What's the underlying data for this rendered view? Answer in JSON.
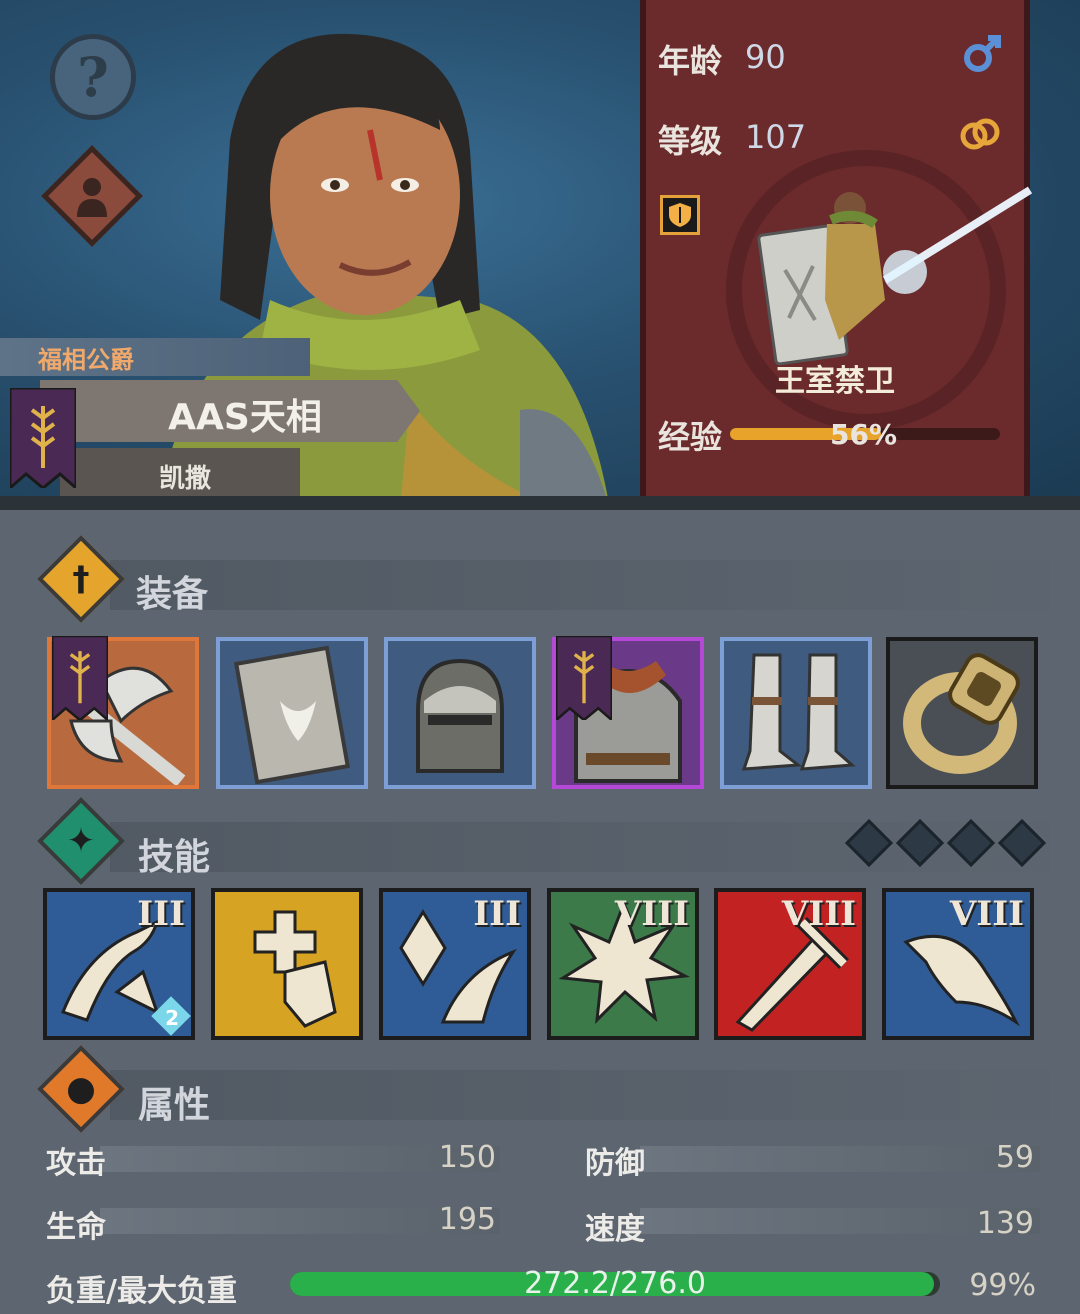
{
  "hero": {
    "title": "福相公爵",
    "name": "AAS天相",
    "sub_name": "凯撒"
  },
  "stats": {
    "age_label": "年龄",
    "age_value": "90",
    "level_label": "等级",
    "level_value": "107",
    "gender_icon": "male-icon",
    "marriage_icon": "rings-icon",
    "unit_name": "王室禁卫",
    "exp_label": "经验",
    "exp_text": "56%",
    "exp_fraction": 0.56
  },
  "equipment": {
    "title": "装备",
    "slots": [
      {
        "name": "weapon-axe",
        "border": "#e0773a",
        "bg": "#b86a3e"
      },
      {
        "name": "shield",
        "border": "#7d9fd6",
        "bg": "#3f5b80"
      },
      {
        "name": "helmet",
        "border": "#7d9fd6",
        "bg": "#3f5b80"
      },
      {
        "name": "chainmail-armor",
        "border": "#b548d6",
        "bg": "#6a3a88"
      },
      {
        "name": "greaves",
        "border": "#7d9fd6",
        "bg": "#3f5b80"
      },
      {
        "name": "ring",
        "border": "#1a1a1a",
        "bg": "#4a4f55"
      }
    ]
  },
  "skills": {
    "title": "技能",
    "items": [
      {
        "name": "skill-charge-break",
        "rank": "III",
        "bg": "#2f5c96",
        "badge": "2"
      },
      {
        "name": "skill-heal-shield",
        "rank": "",
        "bg": "#d7a323"
      },
      {
        "name": "skill-crystal-charge",
        "rank": "III",
        "bg": "#2f5c96"
      },
      {
        "name": "skill-burst",
        "rank": "VIII",
        "bg": "#3c7a4a"
      },
      {
        "name": "skill-sword",
        "rank": "VIII",
        "bg": "#c22222"
      },
      {
        "name": "skill-charge",
        "rank": "VIII",
        "bg": "#2f5c96"
      }
    ]
  },
  "attributes": {
    "title": "属性",
    "attack_label": "攻击",
    "attack_value": "150",
    "defense_label": "防御",
    "defense_value": "59",
    "hp_label": "生命",
    "hp_value": "195",
    "speed_label": "速度",
    "speed_value": "139",
    "load_label": "负重/最大负重",
    "load_text": "272.2/276.0",
    "load_percent": "99%",
    "load_fraction": 0.99
  },
  "colors": {
    "equip_icon": "#e5a52c",
    "skill_icon": "#1f8f6e",
    "attr_icon": "#e07a2a"
  }
}
